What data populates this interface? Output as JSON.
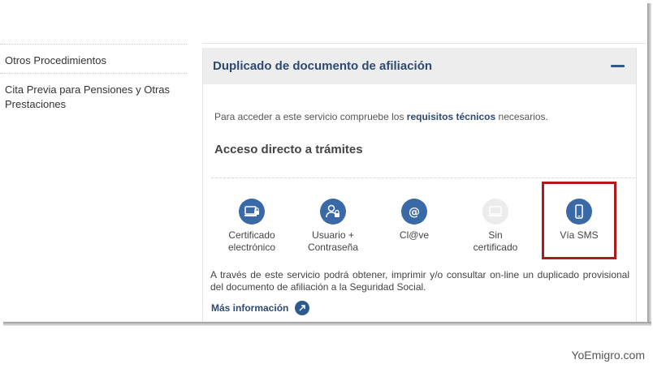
{
  "sidebar": {
    "items": [
      {
        "label": "Otros Procedimientos"
      },
      {
        "label": "Cita Previa para Pensiones y Otras Prestaciones"
      }
    ]
  },
  "panel": {
    "title": "Duplicado de documento de afiliación",
    "requirements": {
      "prefix": "Para acceder a este servicio compruebe los",
      "link": "requisitos técnicos",
      "suffix": "necesarios."
    },
    "access_title": "Acceso directo a trámites",
    "options": [
      {
        "label_line1": "Certificado",
        "label_line2": "electrónico",
        "icon": "certificate-icon"
      },
      {
        "label_line1": "Usuario +",
        "label_line2": "Contraseña",
        "icon": "user-lock-icon"
      },
      {
        "label_line1": "Cl@ve",
        "label_line2": "",
        "icon": "at-icon"
      },
      {
        "label_line1": "Sin",
        "label_line2": "certificado",
        "icon": "monitor-icon"
      },
      {
        "label_line1": "Vía SMS",
        "label_line2": "",
        "icon": "mobile-icon"
      }
    ],
    "description": "A través de este servicio podrá obtener, imprimir y/o consultar on-line un duplicado provisional del documento de afiliación a la Seguridad Social.",
    "more_info": "Más información"
  },
  "watermark": "YoEmigro.com",
  "colors": {
    "accent": "#3a6aa6",
    "title": "#2c4a72",
    "highlight": "#b01a1a"
  }
}
